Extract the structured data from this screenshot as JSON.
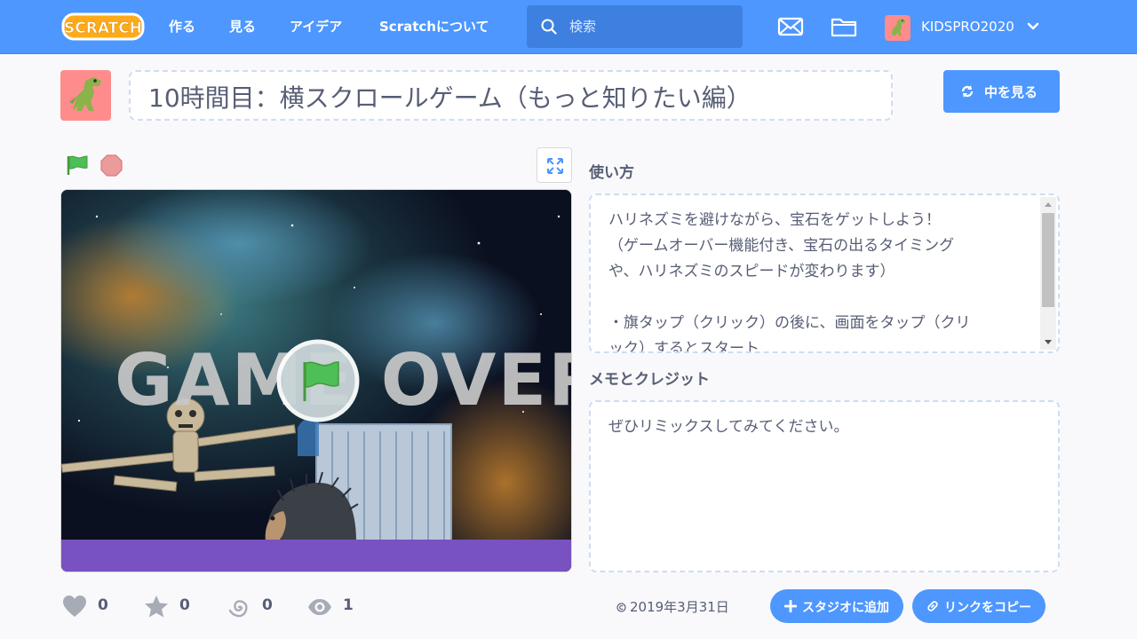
{
  "nav": {
    "logo_text": "SCRATCH",
    "links": [
      "作る",
      "見る",
      "アイデア",
      "Scratchについて"
    ],
    "search_placeholder": "検索",
    "username": "KIDSPRO2020"
  },
  "project": {
    "title": "10時間目：横スクロールゲーム（もっと知りたい編）",
    "see_inside_label": "中を見る"
  },
  "stage": {
    "overlay_text": "GAME OVER"
  },
  "instructions": {
    "label": "使い方",
    "lines": [
      "ハリネズミを避けながら、宝石をゲットしよう！",
      "（ゲームオーバー機能付き、宝石の出るタイミング",
      "や、ハリネズミのスピードが変わります）",
      "",
      "・旗タップ（クリック）の後に、画面をタップ（クリ",
      "ック）するとスタート"
    ]
  },
  "notes": {
    "label": "メモとクレジット",
    "text": "ぜひリミックスしてみてください。"
  },
  "stats": {
    "loves": "0",
    "favorites": "0",
    "remixes": "0",
    "views": "1",
    "date": "2019年3月31日"
  },
  "actions": {
    "add_to_studio": "スタジオに追加",
    "copy_link": "リンクをコピー"
  },
  "colors": {
    "nav_bg": "#4d97ff",
    "button_bg": "#4d97ff",
    "avatar_bg": "#ff8c8c",
    "stage_floor": "#7852c0",
    "flag_green": "#4cbf56",
    "stop_red": "#ec9b9b"
  }
}
